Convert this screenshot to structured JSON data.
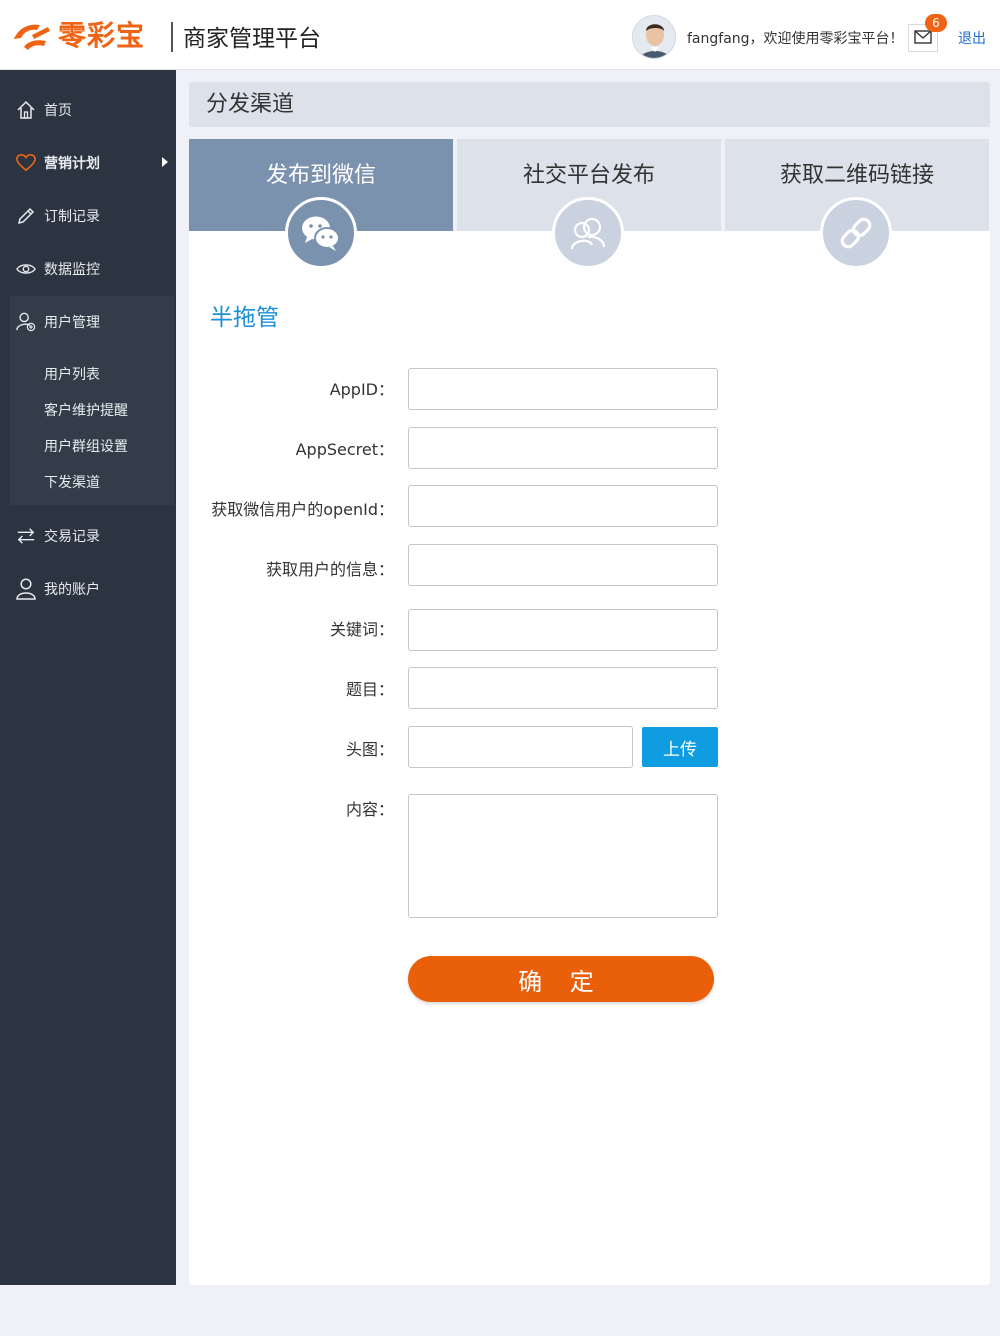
{
  "header": {
    "logo_text": "零彩宝",
    "platform_title": "商家管理平台",
    "username": "fangfang",
    "welcome_text": "fangfang，欢迎使用零彩宝平台！",
    "mail_count": "6",
    "logout_label": "退出"
  },
  "sidebar": {
    "items": [
      {
        "label": "首页",
        "icon": "home-icon"
      },
      {
        "label": "营销计划",
        "icon": "heart-icon"
      },
      {
        "label": "订制记录",
        "icon": "pencil-icon"
      },
      {
        "label": "数据监控",
        "icon": "eye-icon"
      },
      {
        "label": "用户管理",
        "icon": "user-add-icon"
      },
      {
        "label": "交易记录",
        "icon": "exchange-icon"
      },
      {
        "label": "我的账户",
        "icon": "user-icon"
      }
    ],
    "sub_items": [
      {
        "label": "用户列表"
      },
      {
        "label": "客户维护提醒"
      },
      {
        "label": "用户群组设置"
      },
      {
        "label": "下发渠道"
      }
    ]
  },
  "main": {
    "page_title": "分发渠道",
    "tabs": [
      {
        "label": "发布到微信",
        "icon": "wechat-icon",
        "active": true
      },
      {
        "label": "社交平台发布",
        "icon": "social-icon",
        "active": false
      },
      {
        "label": "获取二维码链接",
        "icon": "link-icon",
        "active": false
      }
    ],
    "section_title": "半拖管",
    "form": {
      "appid_label": "AppID：",
      "appsecret_label": "AppSecret：",
      "openid_label": "获取微信用户的openId：",
      "userinfo_label": "获取用户的信息：",
      "keyword_label": "关键词：",
      "subject_label": "题目：",
      "avatar_label": "头图：",
      "content_label": "内容：",
      "upload_label": "上传",
      "confirm_label": "确 定"
    }
  },
  "colors": {
    "brand": "#ee6414",
    "sidebar_bg": "#2b3440",
    "active_tab": "#7b92ae",
    "link_blue": "#1a8fd8",
    "upload_blue": "#0f9ce0",
    "confirm_orange": "#ea5f0a"
  }
}
